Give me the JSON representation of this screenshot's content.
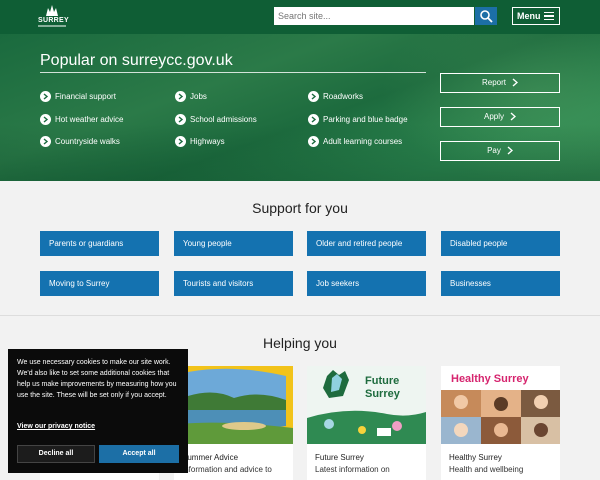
{
  "header": {
    "logo_text": "SURREY",
    "search_placeholder": "Search site...",
    "menu_label": "Menu"
  },
  "hero": {
    "title": "Popular on surreycc.gov.uk",
    "links": [
      "Financial support",
      "Jobs",
      "Roadworks",
      "Hot weather advice",
      "School admissions",
      "Parking and blue badge",
      "Countryside walks",
      "Highways",
      "Adult learning courses"
    ],
    "actions": [
      "Report",
      "Apply",
      "Pay"
    ]
  },
  "support": {
    "title": "Support for you",
    "tiles": [
      "Parents or guardians",
      "Young people",
      "Older and retired people",
      "Disabled people",
      "Moving to Surrey",
      "Tourists and visitors",
      "Job seekers",
      "Businesses"
    ]
  },
  "helping": {
    "title": "Helping you",
    "cards": [
      {
        "title": "",
        "desc": ""
      },
      {
        "title": "Summer Advice",
        "desc": "Information and advice to"
      },
      {
        "title": "Future Surrey",
        "desc": "Latest information on",
        "image_text": "Future Surrey"
      },
      {
        "title": "Healthy Surrey",
        "desc": "Health and wellbeing",
        "image_text": "Healthy Surrey"
      }
    ]
  },
  "cookie": {
    "message": "We use necessary cookies to make our site work. We'd also like to set some additional cookies that help us make improvements by measuring how you use the site. These will be set only if you accept.",
    "policy_link": "View our privacy notice",
    "decline": "Decline all",
    "accept": "Accept all"
  },
  "colors": {
    "header_green": "#0f5e35",
    "tile_blue": "#1472b0",
    "search_blue": "#1c6fa6",
    "future_green": "#1e6b3e",
    "healthy_pink": "#d6246e"
  }
}
